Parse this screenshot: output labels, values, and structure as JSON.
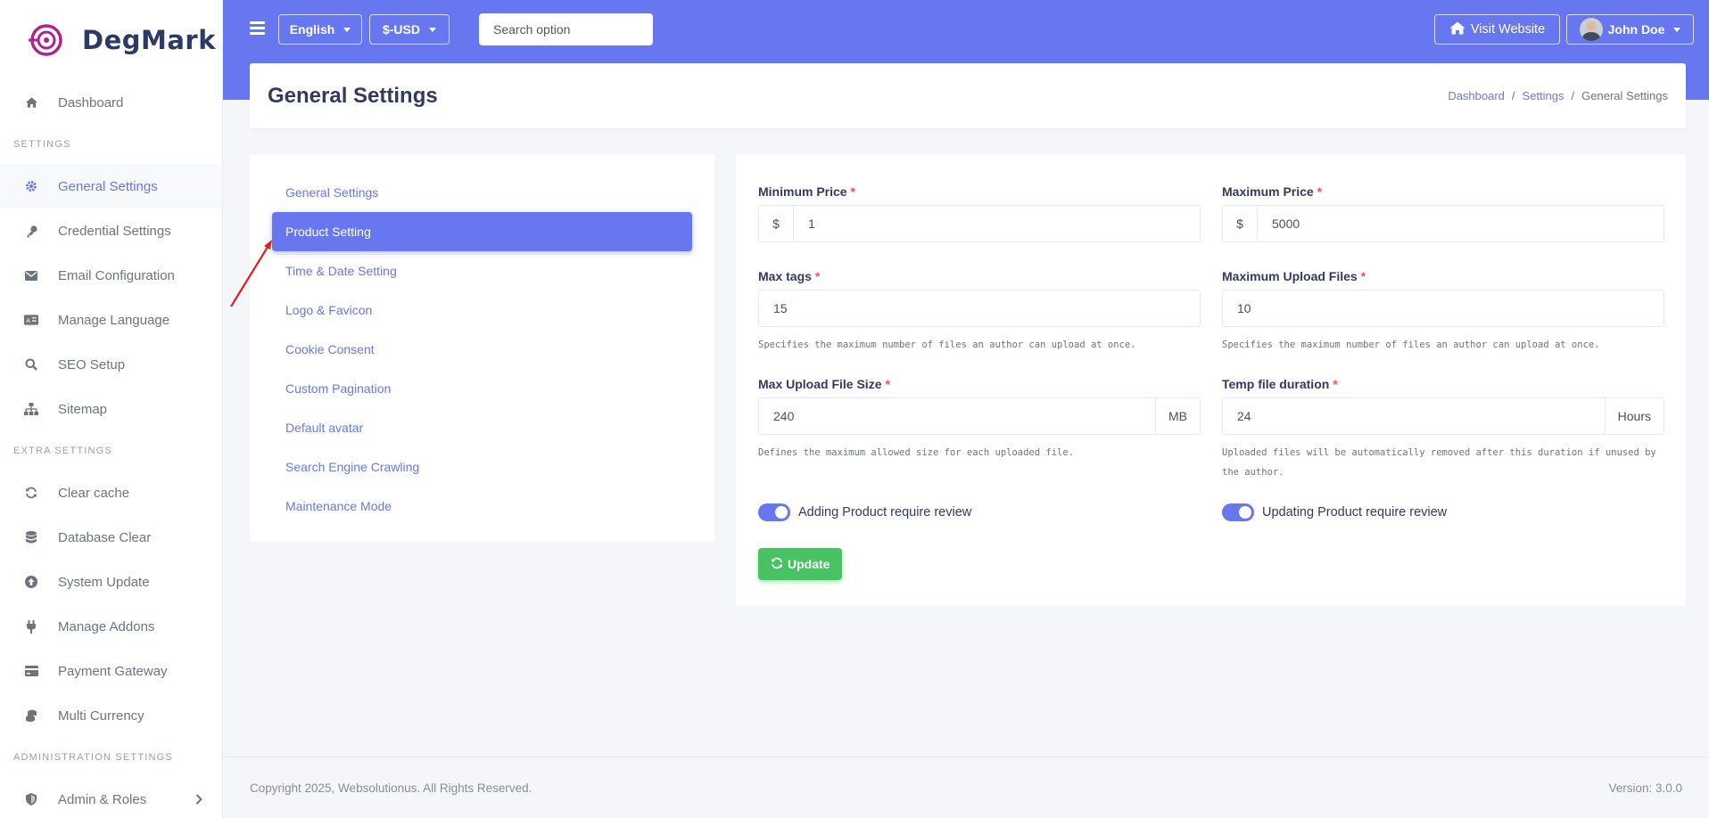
{
  "brand": {
    "name": "DegMark"
  },
  "sidebar": {
    "dashboard": "Dashboard",
    "settings_header": "SETTINGS",
    "settings_items": [
      "General Settings",
      "Credential Settings",
      "Email Configuration",
      "Manage Language",
      "SEO Setup",
      "Sitemap"
    ],
    "extra_header": "EXTRA SETTINGS",
    "extra_items": [
      "Clear cache",
      "Database Clear",
      "System Update",
      "Manage Addons",
      "Payment Gateway",
      "Multi Currency"
    ],
    "admin_header": "ADMINISTRATION SETTINGS",
    "admin_items": [
      "Admin & Roles"
    ]
  },
  "topbar": {
    "language": "English",
    "currency": "$-USD",
    "search_placeholder": "Search option",
    "visit_website": "Visit Website",
    "user_name": "John Doe"
  },
  "page": {
    "title": "General Settings",
    "breadcrumb": [
      "Dashboard",
      "Settings",
      "General Settings"
    ]
  },
  "settings_menu": {
    "items": [
      "General Settings",
      "Product Setting",
      "Time & Date Setting",
      "Logo & Favicon",
      "Cookie Consent",
      "Custom Pagination",
      "Default avatar",
      "Search Engine Crawling",
      "Maintenance Mode"
    ],
    "active": "Product Setting"
  },
  "form": {
    "min_price": {
      "label": "Minimum Price",
      "prefix": "$",
      "value": "1"
    },
    "max_price": {
      "label": "Maximum Price",
      "prefix": "$",
      "value": "5000"
    },
    "max_tags": {
      "label": "Max tags",
      "value": "15",
      "help": "Specifies the maximum number of files an author can upload at once."
    },
    "max_upload_files": {
      "label": "Maximum Upload Files",
      "value": "10",
      "help": "Specifies the maximum number of files an author can upload at once."
    },
    "max_upload_size": {
      "label": "Max Upload File Size",
      "value": "240",
      "suffix": "MB",
      "help": "Defines the maximum allowed size for each uploaded file."
    },
    "temp_duration": {
      "label": "Temp file duration",
      "value": "24",
      "suffix": "Hours",
      "help": "Uploaded files will be automatically removed after this duration if unused by the author."
    },
    "required_mark": "*",
    "toggle_add": {
      "label": "Adding Product require review",
      "on": true
    },
    "toggle_update": {
      "label": "Updating Product require review",
      "on": true
    },
    "update_button": "Update"
  },
  "footer": {
    "copyright": "Copyright 2025, Websolutionus. All Rights Reserved.",
    "version": "Version: 3.0.0"
  },
  "colors": {
    "primary": "#6777ef",
    "success": "#47c363",
    "danger": "#fc544b",
    "annotation": "#e02020"
  }
}
